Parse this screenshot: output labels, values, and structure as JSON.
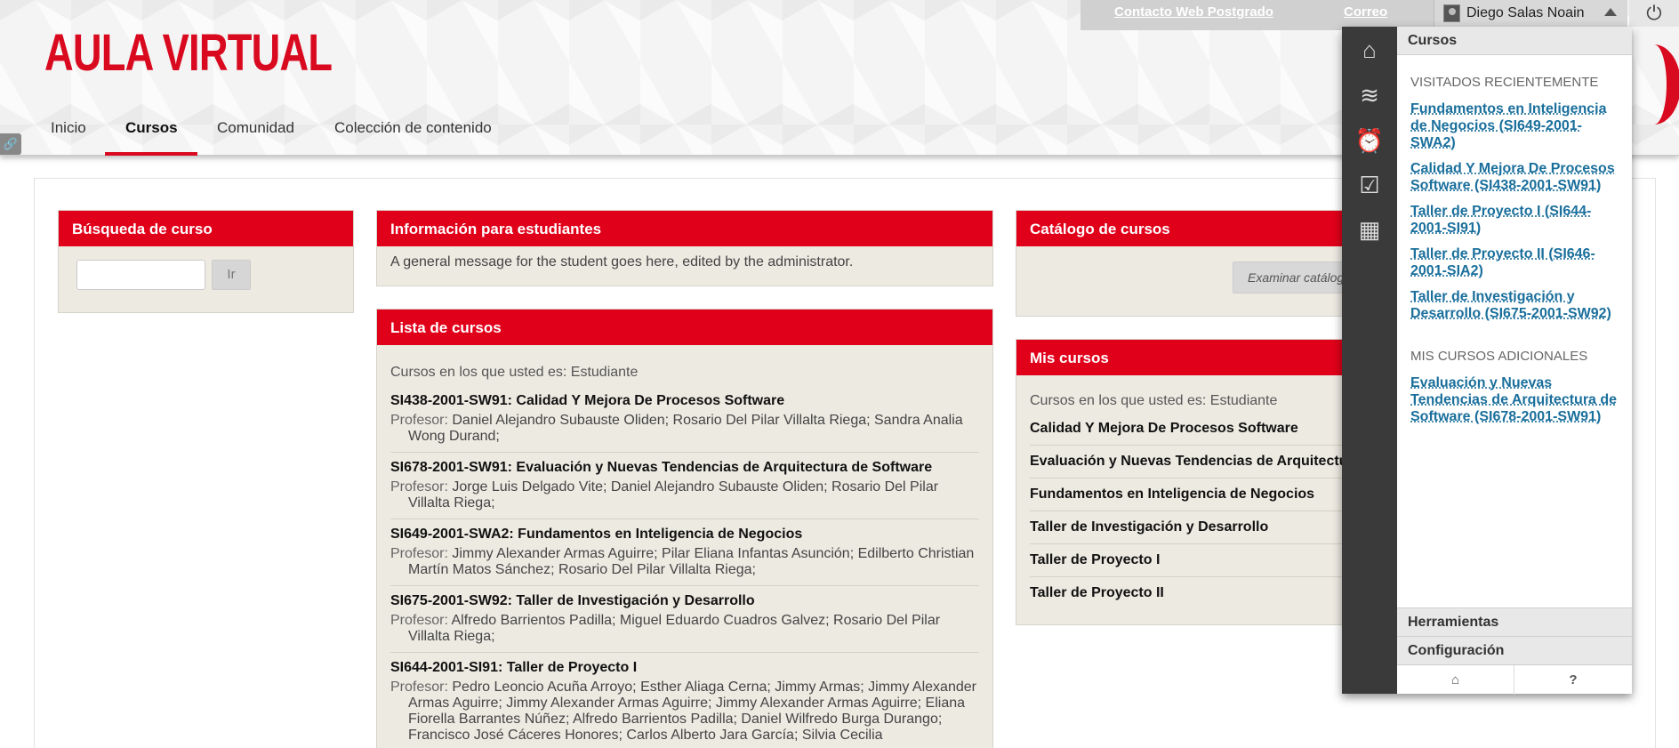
{
  "header": {
    "logo_text": "AULA VIRTUAL",
    "top_links": {
      "contacto": "Contacto Web Postgrado",
      "correo": "Correo"
    },
    "user_name": "Diego Salas Noain",
    "power_icon": "⏻",
    "pin_icon": "🔗"
  },
  "nav": {
    "tabs": [
      {
        "label": "Inicio"
      },
      {
        "label": "Cursos"
      },
      {
        "label": "Comunidad"
      },
      {
        "label": "Colección de contenido"
      }
    ]
  },
  "search": {
    "title": "Búsqueda de curso",
    "button": "Ir"
  },
  "info": {
    "title": "Información para estudiantes",
    "message": "A general message for the student goes here, edited by the administrator."
  },
  "course_list": {
    "title": "Lista de cursos",
    "role": "Cursos en los que usted es: Estudiante",
    "prof_label": "Profesor:",
    "courses": [
      {
        "title": "SI438-2001-SW91: Calidad Y Mejora De Procesos Software",
        "profs": "Daniel Alejandro Subauste Oliden;  Rosario Del Pilar Villalta Riega;  Sandra Analia Wong Durand;"
      },
      {
        "title": "SI678-2001-SW91: Evaluación y Nuevas Tendencias de Arquitectura de Software",
        "profs": "Jorge Luis Delgado Vite;  Daniel Alejandro Subauste Oliden;  Rosario Del Pilar Villalta Riega;"
      },
      {
        "title": "SI649-2001-SWA2: Fundamentos en Inteligencia de Negocios",
        "profs": "Jimmy Alexander Armas Aguirre;  Pilar Eliana Infantas Asunción;  Edilberto Christian Martín Matos Sánchez;  Rosario Del Pilar Villalta Riega;"
      },
      {
        "title": "SI675-2001-SW92: Taller de Investigación y Desarrollo",
        "profs": "Alfredo Barrientos Padilla;  Miguel Eduardo Cuadros Galvez;  Rosario Del Pilar Villalta Riega;"
      },
      {
        "title": "SI644-2001-SI91: Taller de Proyecto I",
        "profs": "Pedro Leoncio Acuña Arroyo;  Esther Aliaga Cerna;  Jimmy Armas;  Jimmy Alexander Armas Aguirre;  Jimmy Alexander Armas Aguirre;  Jimmy Alexander Armas Aguirre;  Eliana Fiorella Barrantes Núñez;  Alfredo Barrientos Padilla;  Daniel Wilfredo Burga Durango;  Francisco José Cáceres Honores;  Carlos Alberto Jara García;  Silvia Cecilia"
      }
    ]
  },
  "catalog": {
    "title": "Catálogo de cursos",
    "button": "Examinar catálogo"
  },
  "my_courses": {
    "title": "Mis cursos",
    "role": "Cursos en los que usted es: Estudiante",
    "items": [
      "Calidad Y Mejora De Procesos Software",
      "Evaluación y Nuevas Tendencias de Arquitectura de Software",
      "Fundamentos en Inteligencia de Negocios",
      "Taller de Investigación y Desarrollo",
      "Taller de Proyecto I",
      "Taller de Proyecto II"
    ]
  },
  "dropdown": {
    "header": "Cursos",
    "recent_label": "VISITADOS RECIENTEMENTE",
    "recent": [
      "Fundamentos en Inteligencia de Negocios (SI649-2001-SWA2)",
      "Calidad Y Mejora De Procesos Software (SI438-2001-SW91)",
      "Taller de Proyecto I (SI644-2001-SI91)",
      "Taller de Proyecto II (SI646-2001-SIA2)",
      "Taller de Investigación y Desarrollo (SI675-2001-SW92)"
    ],
    "additional_label": "MIS CURSOS ADICIONALES",
    "additional": [
      "Evaluación y Nuevas Tendencias de Arquitectura de Software (SI678-2001-SW91)"
    ],
    "tools": "Herramientas",
    "settings": "Configuración",
    "bottom_help": "?",
    "rail_icons": [
      "home-bb-icon",
      "activity-stream-icon",
      "alarm-clock-icon",
      "tasks-check-icon",
      "calendar-icon"
    ]
  }
}
